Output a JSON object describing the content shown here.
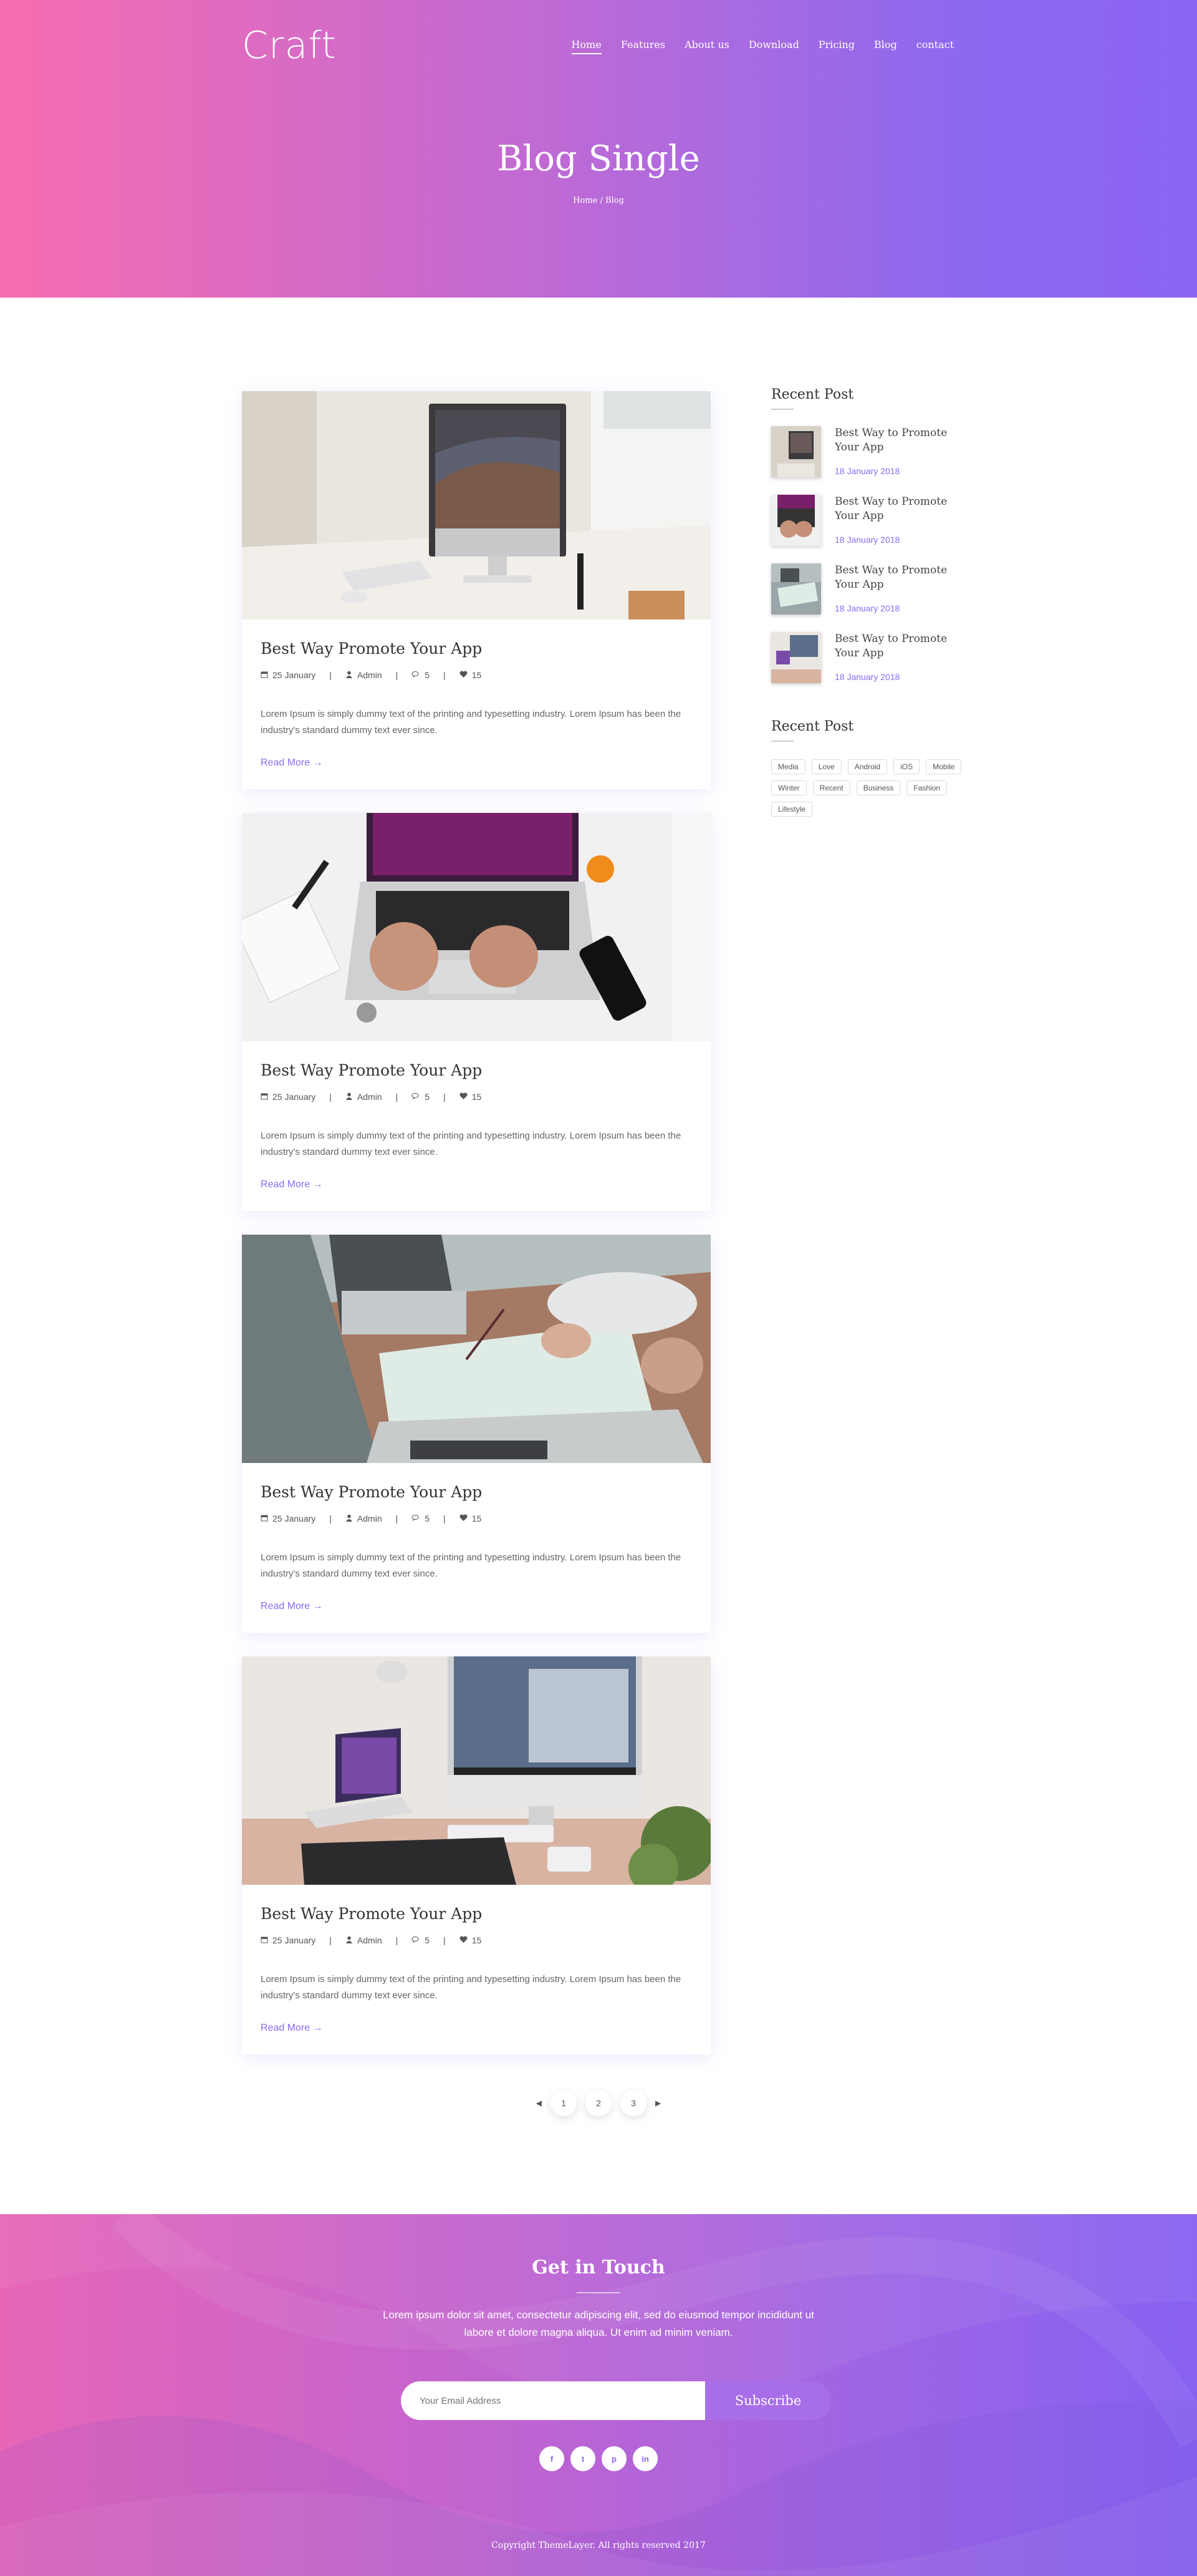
{
  "header": {
    "logo": "Craft",
    "nav": [
      "Home",
      "Features",
      "About us",
      "Download",
      "Pricing",
      "Blog",
      "contact"
    ],
    "active_nav": "Home",
    "title": "Blog Single",
    "breadcrumb": "Home / Blog"
  },
  "posts": [
    {
      "title": "Best Way Promote Your App",
      "date": "25 January",
      "author": "Admin",
      "comments": "5",
      "likes": "15",
      "excerpt": "Lorem Ipsum is simply dummy text of the printing and typesetting industry. Lorem Ipsum has been the industry's standard dummy text ever since.",
      "read_more": "Read More →"
    },
    {
      "title": "Best Way Promote Your App",
      "date": "25 January",
      "author": "Admin",
      "comments": "5",
      "likes": "15",
      "excerpt": "Lorem Ipsum is simply dummy text of the printing and typesetting industry. Lorem Ipsum has been the industry's standard dummy text ever since.",
      "read_more": "Read More →"
    },
    {
      "title": "Best Way Promote Your App",
      "date": "25 January",
      "author": "Admin",
      "comments": "5",
      "likes": "15",
      "excerpt": "Lorem Ipsum is simply dummy text of the printing and typesetting industry. Lorem Ipsum has been the industry's standard dummy text ever since.",
      "read_more": "Read More →"
    },
    {
      "title": "Best Way Promote Your App",
      "date": "25 January",
      "author": "Admin",
      "comments": "5",
      "likes": "15",
      "excerpt": "Lorem Ipsum is simply dummy text of the printing and typesetting industry. Lorem Ipsum has been the industry's standard dummy text ever since.",
      "read_more": "Read More →"
    }
  ],
  "sidebar": {
    "recent_title": "Recent Post",
    "recent": [
      {
        "title": "Best Way to Promote Your App",
        "date": "18 January 2018"
      },
      {
        "title": "Best Way to Promote Your App",
        "date": "18 January 2018"
      },
      {
        "title": "Best Way to Promote Your App",
        "date": "18 January 2018"
      },
      {
        "title": "Best Way to Promote Your App",
        "date": "18 January 2018"
      }
    ],
    "tags_title": "Recent Post",
    "tags": [
      "Media",
      "Love",
      "Android",
      "iOS",
      "Mobile",
      "Winter",
      "Recent",
      "Business",
      "Fashion",
      "Lifestyle"
    ]
  },
  "pagination": {
    "prev": "◀",
    "pages": [
      "1",
      "2",
      "3"
    ],
    "next": "▶"
  },
  "footer": {
    "title": "Get in Touch",
    "text": "Lorem ipsum dolor sit amet, consectetur adipiscing elit, sed do eiusmod tempor incididunt ut labore et dolore magna aliqua. Ut enim ad minim veniam.",
    "email_placeholder": "Your Email Address",
    "subscribe": "Subscribe",
    "social": [
      {
        "icon": "facebook-icon",
        "glyph": "f"
      },
      {
        "icon": "twitter-icon",
        "glyph": "t"
      },
      {
        "icon": "pinterest-icon",
        "glyph": "p"
      },
      {
        "icon": "linkedin-icon",
        "glyph": "in"
      }
    ],
    "copyright": "Copyright ThemeLayer. All rights reserved 2017"
  },
  "colors": {
    "accent": "#8b6cf2",
    "gradient_start": "#f76cb0",
    "gradient_end": "#8b65f4"
  }
}
